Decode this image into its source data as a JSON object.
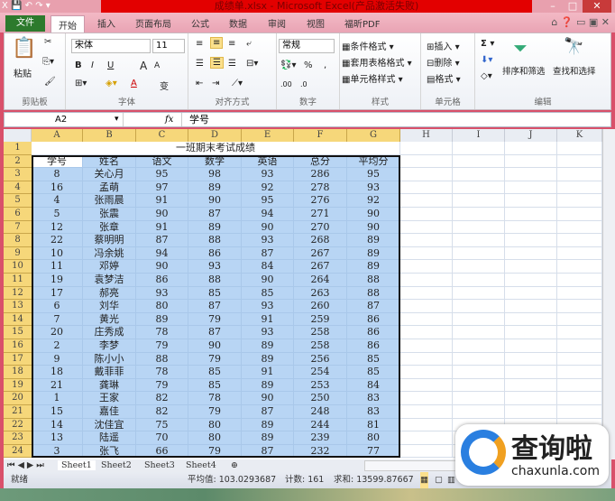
{
  "window": {
    "title": "成绩单.xlsx - Microsoft Excel(产品激活失败)",
    "controls": [
      "–",
      "□",
      "✕"
    ]
  },
  "tabs": [
    "文件",
    "开始",
    "插入",
    "页面布局",
    "公式",
    "数据",
    "审阅",
    "视图",
    "福昕PDF"
  ],
  "ribbon": {
    "clipboard": {
      "paste": "粘贴",
      "label": "剪贴板"
    },
    "font": {
      "name": "宋体",
      "size": "11",
      "bold": "B",
      "italic": "I",
      "underline": "U",
      "grow": "A",
      "shrink": "A",
      "color": "A",
      "wen": "变",
      "label": "字体"
    },
    "align": {
      "label": "对齐方式"
    },
    "number": {
      "format": "常规",
      "percent": "%",
      "comma": ",",
      "inc": ".00",
      "dec": ".0",
      "label": "数字"
    },
    "styles": {
      "items": [
        "条件格式 ▾",
        "套用表格格式 ▾",
        "单元格样式 ▾"
      ],
      "label": "样式"
    },
    "cells": {
      "items": [
        "插入 ▾",
        "删除 ▾",
        "格式 ▾"
      ],
      "label": "单元格"
    },
    "editing": {
      "sigma": "Σ ▾",
      "sort": "排序和筛选",
      "find": "查找和选择",
      "label": "编辑"
    }
  },
  "formula_bar": {
    "name_box": "A2",
    "fx": "fx",
    "value": "学号"
  },
  "columns": [
    "A",
    "B",
    "C",
    "D",
    "E",
    "F",
    "G",
    "H",
    "I",
    "J",
    "K"
  ],
  "sheet": {
    "title": "一班期末考试成绩",
    "headers": [
      "学号",
      "姓名",
      "语文",
      "数学",
      "英语",
      "总分",
      "平均分"
    ],
    "rows": [
      [
        "8",
        "关心月",
        "95",
        "98",
        "93",
        "286",
        "95"
      ],
      [
        "16",
        "孟萌",
        "97",
        "89",
        "92",
        "278",
        "93"
      ],
      [
        "4",
        "张雨晨",
        "91",
        "90",
        "95",
        "276",
        "92"
      ],
      [
        "5",
        "张震",
        "90",
        "87",
        "94",
        "271",
        "90"
      ],
      [
        "12",
        "张章",
        "91",
        "89",
        "90",
        "270",
        "90"
      ],
      [
        "22",
        "蔡明明",
        "87",
        "88",
        "93",
        "268",
        "89"
      ],
      [
        "10",
        "冯余姚",
        "94",
        "86",
        "87",
        "267",
        "89"
      ],
      [
        "11",
        "邓婷",
        "90",
        "93",
        "84",
        "267",
        "89"
      ],
      [
        "19",
        "袁梦洁",
        "86",
        "88",
        "90",
        "264",
        "88"
      ],
      [
        "17",
        "郝亮",
        "93",
        "85",
        "85",
        "263",
        "88"
      ],
      [
        "6",
        "刘华",
        "80",
        "87",
        "93",
        "260",
        "87"
      ],
      [
        "7",
        "黄光",
        "89",
        "79",
        "91",
        "259",
        "86"
      ],
      [
        "20",
        "庄秀成",
        "78",
        "87",
        "93",
        "258",
        "86"
      ],
      [
        "2",
        "李梦",
        "79",
        "90",
        "89",
        "258",
        "86"
      ],
      [
        "9",
        "陈小小",
        "88",
        "79",
        "89",
        "256",
        "85"
      ],
      [
        "18",
        "戴菲菲",
        "78",
        "85",
        "91",
        "254",
        "85"
      ],
      [
        "21",
        "龚琳",
        "79",
        "85",
        "89",
        "253",
        "84"
      ],
      [
        "1",
        "王家",
        "82",
        "78",
        "90",
        "250",
        "83"
      ],
      [
        "15",
        "嘉佳",
        "82",
        "79",
        "87",
        "248",
        "83"
      ],
      [
        "14",
        "沈佳宜",
        "75",
        "80",
        "89",
        "244",
        "81"
      ],
      [
        "13",
        "陆遥",
        "70",
        "80",
        "89",
        "239",
        "80"
      ],
      [
        "3",
        "张飞",
        "66",
        "79",
        "87",
        "232",
        "77"
      ]
    ]
  },
  "sheet_tabs": [
    "Sheet1",
    "Sheet2",
    "Sheet3",
    "Sheet4"
  ],
  "status": {
    "ready": "就绪",
    "average": "平均值: 103.0293687",
    "count": "计数: 161",
    "sum": "求和: 13599.87667"
  },
  "watermark": {
    "cn": "查询啦",
    "url": "chaxunla.com"
  }
}
